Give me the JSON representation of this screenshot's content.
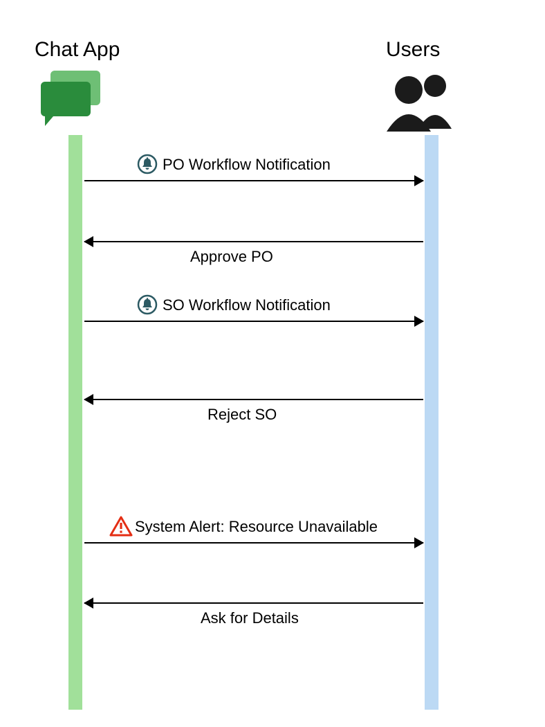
{
  "actors": {
    "left": {
      "label": "Chat App"
    },
    "right": {
      "label": "Users"
    }
  },
  "messages": {
    "m1": {
      "label": "PO Workflow Notification",
      "icon": "bell-icon"
    },
    "m2": {
      "label": "Approve PO"
    },
    "m3": {
      "label": "SO Workflow Notification",
      "icon": "bell-icon"
    },
    "m4": {
      "label": "Reject SO"
    },
    "m5": {
      "label": "System Alert: Resource Unavailable",
      "icon": "alert-icon"
    },
    "m6": {
      "label": "Ask for Details"
    }
  },
  "colors": {
    "left_lifeline": "#a1e09a",
    "right_lifeline": "#bcd9f4",
    "chat_bubble_front": "#2a8c3c",
    "chat_bubble_back": "#6ebf75",
    "bell_stroke": "#2c5a63",
    "alert_red": "#e42e14"
  }
}
